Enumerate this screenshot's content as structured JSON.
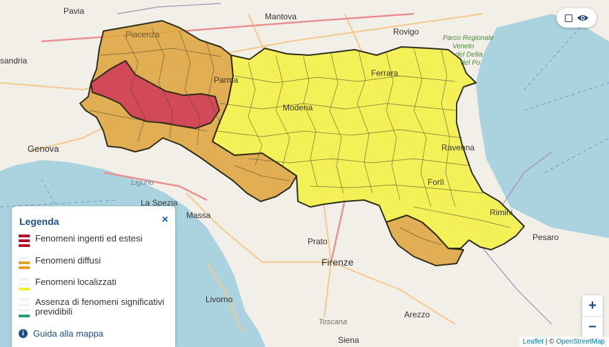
{
  "map": {
    "places": [
      {
        "name": "Pavia"
      },
      {
        "name": "Mantova"
      },
      {
        "name": "Rovigo"
      },
      {
        "name": "sandria"
      },
      {
        "name": "Genova"
      },
      {
        "name": "Parma"
      },
      {
        "name": "Modena"
      },
      {
        "name": "Ferrara"
      },
      {
        "name": "Ravenna"
      },
      {
        "name": "Forlì"
      },
      {
        "name": "Rimini"
      },
      {
        "name": "Pesaro"
      },
      {
        "name": "La Spezia"
      },
      {
        "name": "Massa"
      },
      {
        "name": "Prato"
      },
      {
        "name": "Firenze"
      },
      {
        "name": "Livorno"
      },
      {
        "name": "Arezzo"
      },
      {
        "name": "Siena"
      },
      {
        "name": "Piacenza"
      }
    ],
    "sea_labels": [
      "Ligur",
      "Ligurio"
    ],
    "region_labels": [
      "Toscana"
    ],
    "park_label": [
      "Parco Regionale",
      "Veneto",
      "del Delta",
      "del Po"
    ]
  },
  "toggle": {
    "checkbox_icon": "checkbox-icon",
    "eye_icon": "eye-icon"
  },
  "legend": {
    "title": "Legenda",
    "close_icon": "×",
    "items": [
      {
        "label": "Fenomeni ingenti ed estesi",
        "color": "#b5102a",
        "stripes": 3
      },
      {
        "label": "Fenomeni diffusi",
        "color": "#e0a22b",
        "stripes": 2
      },
      {
        "label": "Fenomeni localizzati",
        "color": "#f2ef2a",
        "stripes": 1
      },
      {
        "label": "Assenza di fenomeni significativi previdibili",
        "color": "#2f9a6d",
        "stripes": 0
      }
    ],
    "guide_icon": "i",
    "guide_label": "Guida alla mappa"
  },
  "zoom": {
    "in": "+",
    "out": "−"
  },
  "attribution": {
    "leaflet": "Leaflet",
    "separator": " | © ",
    "osm": "OpenStreetMap"
  },
  "colors": {
    "land": "#f2efe9",
    "sea": "#aad3df",
    "red": "#d04058",
    "orange": "#e0a642",
    "yellow": "#f4f048",
    "border": "#2d2d1a",
    "road": "#f5c98a",
    "motorway": "#e98f8f"
  }
}
